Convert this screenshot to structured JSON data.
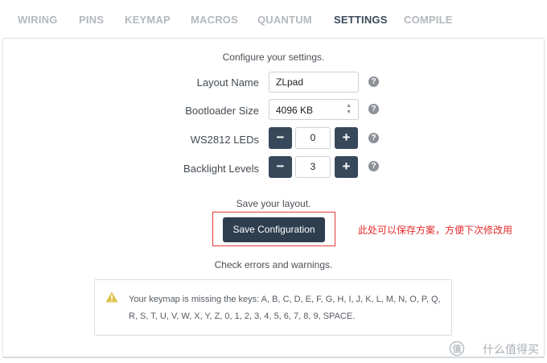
{
  "tabs": [
    "WIRING",
    "PINS",
    "KEYMAP",
    "MACROS",
    "QUANTUM",
    "SETTINGS",
    "COMPILE"
  ],
  "active_tab": "SETTINGS",
  "settings": {
    "intro": "Configure your settings.",
    "layout_name": {
      "label": "Layout Name",
      "value": "ZLpad"
    },
    "bootloader_size": {
      "label": "Bootloader Size",
      "value": "4096 KB"
    },
    "ws2812_leds": {
      "label": "WS2812 LEDs",
      "value": "0"
    },
    "backlight_levels": {
      "label": "Backlight Levels",
      "value": "3"
    },
    "help_glyph": "?"
  },
  "save": {
    "intro": "Save your layout.",
    "button_label": "Save Configuration",
    "annotation": "此处可以保存方案，方便下次修改用"
  },
  "warnings": {
    "intro": "Check errors and warnings.",
    "message": "Your keymap is missing the keys: A, B, C, D, E, F, G, H, I, J, K, L, M, N, O, P, Q, R, S, T, U, V, W, X, Y, Z, 0, 1, 2, 3, 4, 5, 6, 7, 8, 9, SPACE.",
    "icon": "warning-triangle",
    "warning_color": "#e0c040"
  },
  "watermark": "什么值得买",
  "colors": {
    "accent": "#37485a",
    "annotation": "#e32b2b",
    "active_tab": "#3b4a5a",
    "inactive_tab": "#b4b8bc"
  }
}
